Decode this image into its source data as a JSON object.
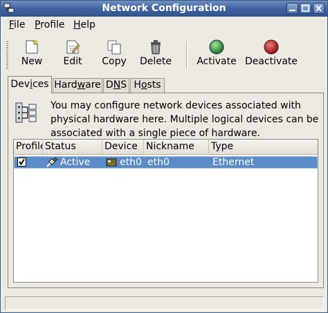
{
  "window": {
    "title": "Network Configuration"
  },
  "menu": [
    {
      "u": "F",
      "rest": "ile"
    },
    {
      "u": "P",
      "rest": "rofile"
    },
    {
      "u": "H",
      "rest": "elp"
    }
  ],
  "toolbar": {
    "new": "New",
    "edit": "Edit",
    "copy": "Copy",
    "delete": "Delete",
    "activate": "Activate",
    "deactivate": "Deactivate"
  },
  "tabs": [
    {
      "pre": "Dev",
      "u": "i",
      "post": "ces"
    },
    {
      "pre": "Hard",
      "u": "w",
      "post": "are"
    },
    {
      "pre": "D",
      "u": "N",
      "post": "S"
    },
    {
      "pre": "H",
      "u": "o",
      "post": "sts"
    }
  ],
  "devices_panel": {
    "description": "You may configure network devices associated with physical hardware here.  Multiple logical devices can be associated with a single piece of hardware.",
    "columns": [
      "Profile",
      "Status",
      "Device",
      "Nickname",
      "Type"
    ],
    "rows": [
      {
        "profile_checked": true,
        "status": "Active",
        "device": "eth0",
        "nickname": "eth0",
        "type": "Ethernet"
      }
    ]
  },
  "colors": {
    "titlebar": "#3e62a0",
    "selection": "#5b8cc8",
    "activate_icon": "#2e8b2e",
    "deactivate_icon": "#b01818"
  },
  "icons": [
    "network-config-icon",
    "minimize-icon",
    "maximize-icon",
    "close-icon",
    "new-icon",
    "edit-icon",
    "copy-icon",
    "delete-icon",
    "activate-icon",
    "deactivate-icon",
    "network-devices-icon",
    "active-status-icon",
    "ethernet-card-icon"
  ]
}
